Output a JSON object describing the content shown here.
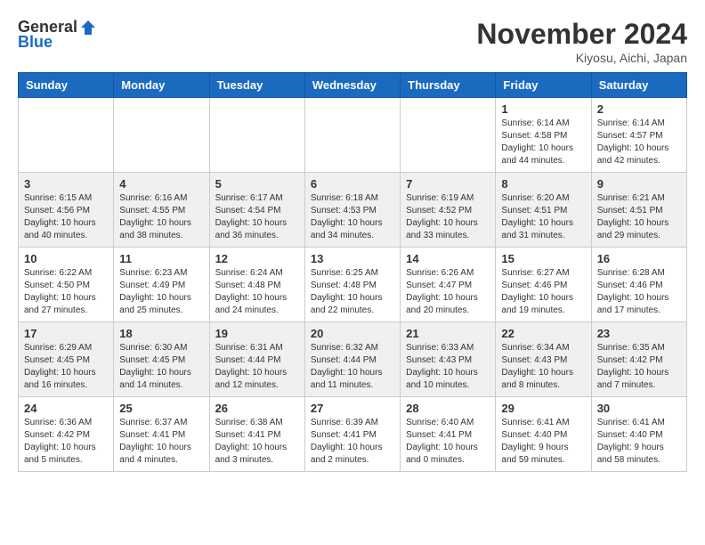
{
  "header": {
    "logo_general": "General",
    "logo_blue": "Blue",
    "month_title": "November 2024",
    "location": "Kiyosu, Aichi, Japan"
  },
  "weekdays": [
    "Sunday",
    "Monday",
    "Tuesday",
    "Wednesday",
    "Thursday",
    "Friday",
    "Saturday"
  ],
  "weeks": [
    [
      {
        "day": "",
        "info": ""
      },
      {
        "day": "",
        "info": ""
      },
      {
        "day": "",
        "info": ""
      },
      {
        "day": "",
        "info": ""
      },
      {
        "day": "",
        "info": ""
      },
      {
        "day": "1",
        "info": "Sunrise: 6:14 AM\nSunset: 4:58 PM\nDaylight: 10 hours and 44 minutes."
      },
      {
        "day": "2",
        "info": "Sunrise: 6:14 AM\nSunset: 4:57 PM\nDaylight: 10 hours and 42 minutes."
      }
    ],
    [
      {
        "day": "3",
        "info": "Sunrise: 6:15 AM\nSunset: 4:56 PM\nDaylight: 10 hours and 40 minutes."
      },
      {
        "day": "4",
        "info": "Sunrise: 6:16 AM\nSunset: 4:55 PM\nDaylight: 10 hours and 38 minutes."
      },
      {
        "day": "5",
        "info": "Sunrise: 6:17 AM\nSunset: 4:54 PM\nDaylight: 10 hours and 36 minutes."
      },
      {
        "day": "6",
        "info": "Sunrise: 6:18 AM\nSunset: 4:53 PM\nDaylight: 10 hours and 34 minutes."
      },
      {
        "day": "7",
        "info": "Sunrise: 6:19 AM\nSunset: 4:52 PM\nDaylight: 10 hours and 33 minutes."
      },
      {
        "day": "8",
        "info": "Sunrise: 6:20 AM\nSunset: 4:51 PM\nDaylight: 10 hours and 31 minutes."
      },
      {
        "day": "9",
        "info": "Sunrise: 6:21 AM\nSunset: 4:51 PM\nDaylight: 10 hours and 29 minutes."
      }
    ],
    [
      {
        "day": "10",
        "info": "Sunrise: 6:22 AM\nSunset: 4:50 PM\nDaylight: 10 hours and 27 minutes."
      },
      {
        "day": "11",
        "info": "Sunrise: 6:23 AM\nSunset: 4:49 PM\nDaylight: 10 hours and 25 minutes."
      },
      {
        "day": "12",
        "info": "Sunrise: 6:24 AM\nSunset: 4:48 PM\nDaylight: 10 hours and 24 minutes."
      },
      {
        "day": "13",
        "info": "Sunrise: 6:25 AM\nSunset: 4:48 PM\nDaylight: 10 hours and 22 minutes."
      },
      {
        "day": "14",
        "info": "Sunrise: 6:26 AM\nSunset: 4:47 PM\nDaylight: 10 hours and 20 minutes."
      },
      {
        "day": "15",
        "info": "Sunrise: 6:27 AM\nSunset: 4:46 PM\nDaylight: 10 hours and 19 minutes."
      },
      {
        "day": "16",
        "info": "Sunrise: 6:28 AM\nSunset: 4:46 PM\nDaylight: 10 hours and 17 minutes."
      }
    ],
    [
      {
        "day": "17",
        "info": "Sunrise: 6:29 AM\nSunset: 4:45 PM\nDaylight: 10 hours and 16 minutes."
      },
      {
        "day": "18",
        "info": "Sunrise: 6:30 AM\nSunset: 4:45 PM\nDaylight: 10 hours and 14 minutes."
      },
      {
        "day": "19",
        "info": "Sunrise: 6:31 AM\nSunset: 4:44 PM\nDaylight: 10 hours and 12 minutes."
      },
      {
        "day": "20",
        "info": "Sunrise: 6:32 AM\nSunset: 4:44 PM\nDaylight: 10 hours and 11 minutes."
      },
      {
        "day": "21",
        "info": "Sunrise: 6:33 AM\nSunset: 4:43 PM\nDaylight: 10 hours and 10 minutes."
      },
      {
        "day": "22",
        "info": "Sunrise: 6:34 AM\nSunset: 4:43 PM\nDaylight: 10 hours and 8 minutes."
      },
      {
        "day": "23",
        "info": "Sunrise: 6:35 AM\nSunset: 4:42 PM\nDaylight: 10 hours and 7 minutes."
      }
    ],
    [
      {
        "day": "24",
        "info": "Sunrise: 6:36 AM\nSunset: 4:42 PM\nDaylight: 10 hours and 5 minutes."
      },
      {
        "day": "25",
        "info": "Sunrise: 6:37 AM\nSunset: 4:41 PM\nDaylight: 10 hours and 4 minutes."
      },
      {
        "day": "26",
        "info": "Sunrise: 6:38 AM\nSunset: 4:41 PM\nDaylight: 10 hours and 3 minutes."
      },
      {
        "day": "27",
        "info": "Sunrise: 6:39 AM\nSunset: 4:41 PM\nDaylight: 10 hours and 2 minutes."
      },
      {
        "day": "28",
        "info": "Sunrise: 6:40 AM\nSunset: 4:41 PM\nDaylight: 10 hours and 0 minutes."
      },
      {
        "day": "29",
        "info": "Sunrise: 6:41 AM\nSunset: 4:40 PM\nDaylight: 9 hours and 59 minutes."
      },
      {
        "day": "30",
        "info": "Sunrise: 6:41 AM\nSunset: 4:40 PM\nDaylight: 9 hours and 58 minutes."
      }
    ]
  ]
}
